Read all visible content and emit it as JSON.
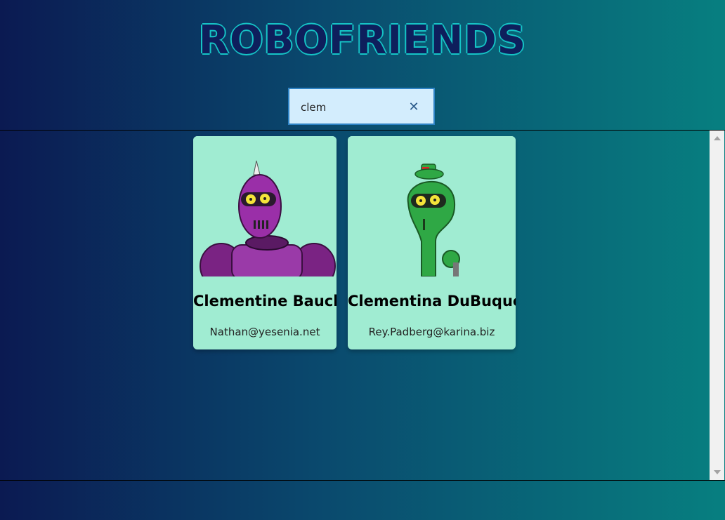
{
  "app": {
    "title": "ROBOFRIENDS"
  },
  "search": {
    "value": "clem",
    "clear_icon": "close-icon"
  },
  "robots": [
    {
      "name": "Clementine Bauch",
      "email": "Nathan@yesenia.net",
      "color": "#8e2a9c"
    },
    {
      "name": "Clementina DuBuque",
      "email": "Rey.Padberg@karina.biz",
      "color": "#2fa845"
    }
  ],
  "colors": {
    "card_bg": "#a0ecd2",
    "title": "#16c4c6",
    "search_bg": "#d3edfd"
  }
}
